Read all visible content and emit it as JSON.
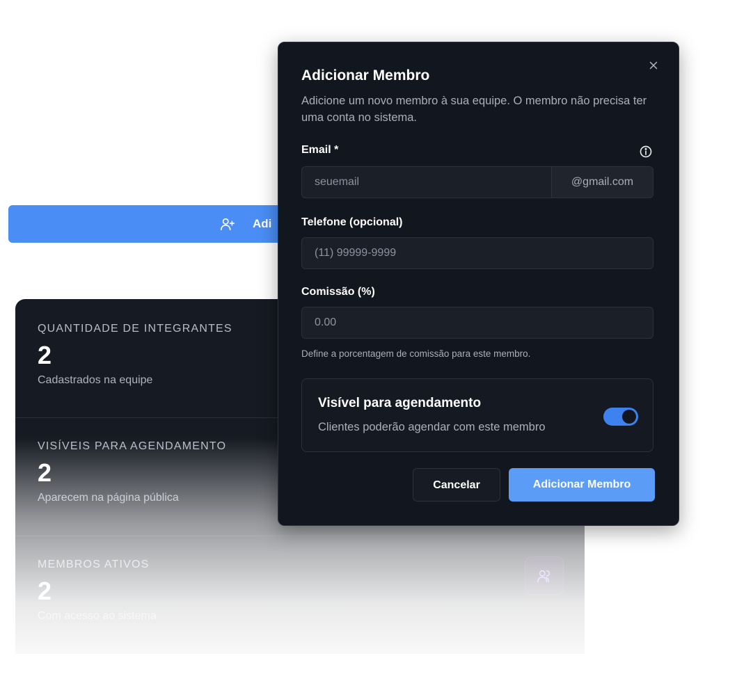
{
  "background_button": {
    "label": "Adi",
    "icon": "user-plus-icon",
    "color": "#4a8ef5"
  },
  "stats": [
    {
      "title": "QUANTIDADE DE INTEGRANTES",
      "value": "2",
      "subtitle": "Cadastrados na equipe"
    },
    {
      "title": "VISÍVEIS PARA AGENDAMENTO",
      "value": "2",
      "subtitle": "Aparecem na página pública"
    },
    {
      "title": "MEMBROS ATIVOS",
      "value": "2",
      "subtitle": "Com acesso ao sistema",
      "icon": "users-icon"
    }
  ],
  "dialog": {
    "title": "Adicionar Membro",
    "description": "Adicione um novo membro à sua equipe. O membro não precisa ter uma conta no sistema.",
    "close_icon": "close-icon",
    "email": {
      "label": "Email *",
      "placeholder": "seuemail",
      "suffix": "@gmail.com",
      "info_icon": "info-icon"
    },
    "phone": {
      "label": "Telefone (opcional)",
      "placeholder": "(11) 99999-9999"
    },
    "commission": {
      "label": "Comissão (%)",
      "placeholder": "0.00",
      "hint": "Define a porcentagem de comissão para este membro."
    },
    "visibility": {
      "title": "Visível para agendamento",
      "subtitle": "Clientes poderão agendar com este membro",
      "enabled": true
    },
    "buttons": {
      "cancel": "Cancelar",
      "submit": "Adicionar Membro"
    }
  },
  "colors": {
    "dialog_bg": "#12161e",
    "accent": "#5b9cf7",
    "toggle_on": "#3e82f0"
  }
}
